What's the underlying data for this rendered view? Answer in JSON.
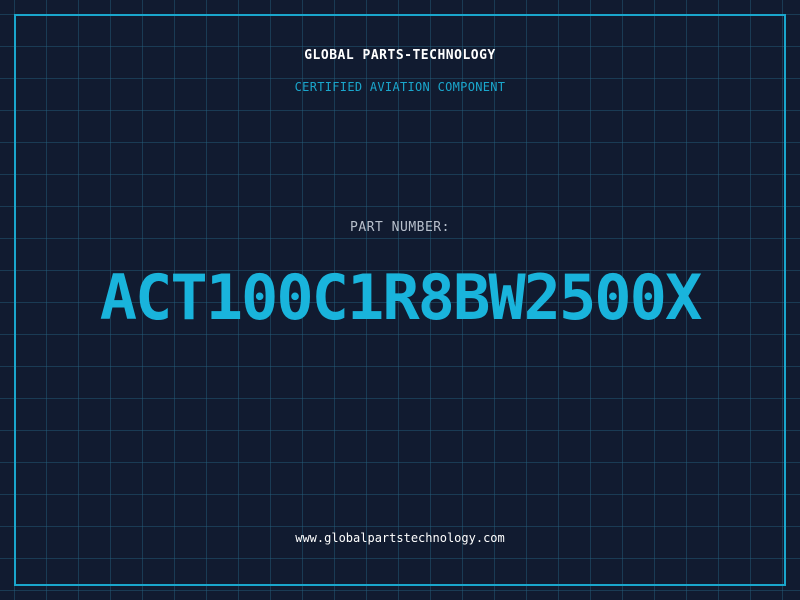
{
  "header": {
    "company": "GLOBAL PARTS-TECHNOLOGY",
    "subtitle": "CERTIFIED AVIATION COMPONENT"
  },
  "part": {
    "label": "PART NUMBER:",
    "number": "ACT100C1R8BW2500X"
  },
  "footer": {
    "website": "www.globalpartstechnology.com"
  },
  "colors": {
    "background": "#111b30",
    "accent": "#19b4dc",
    "grid": "#266280",
    "label": "#b8c0cc",
    "text": "#ffffff"
  }
}
